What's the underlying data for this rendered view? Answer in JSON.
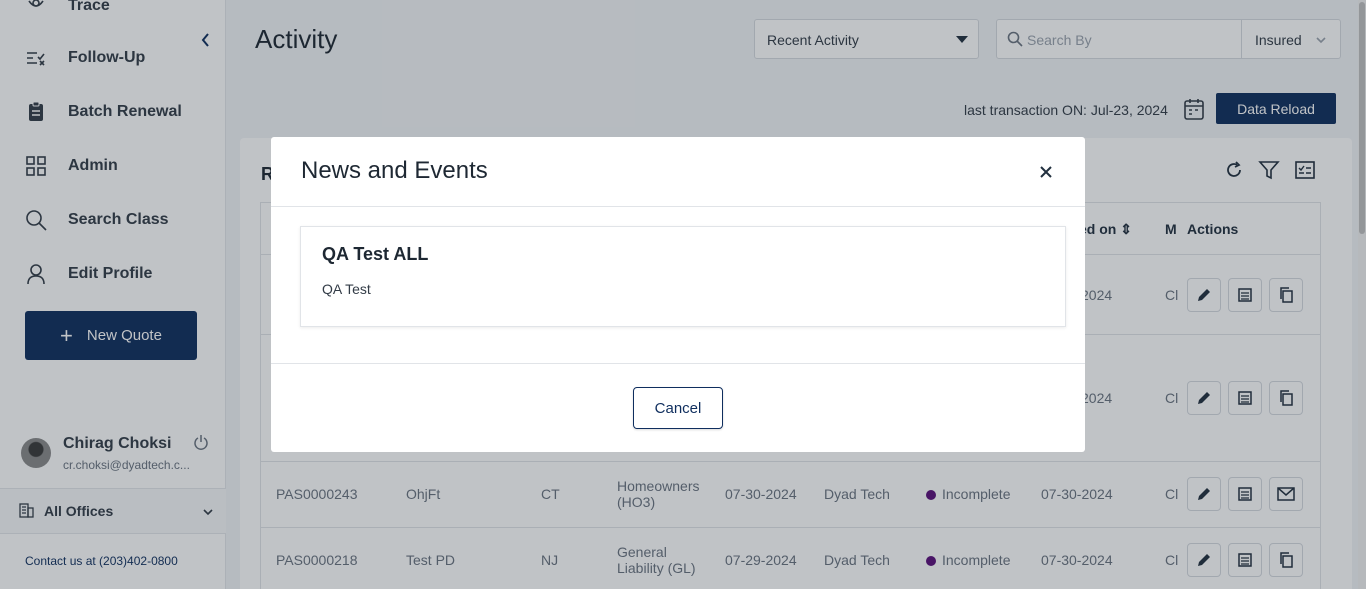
{
  "sidebar": {
    "items": [
      {
        "label": "Trace",
        "icon": "trace-icon"
      },
      {
        "label": "Follow-Up",
        "icon": "follow-up-icon"
      },
      {
        "label": "Batch Renewal",
        "icon": "clipboard-icon"
      },
      {
        "label": "Admin",
        "icon": "grid-icon"
      },
      {
        "label": "Search Class",
        "icon": "search-icon"
      },
      {
        "label": "Edit Profile",
        "icon": "user-icon"
      }
    ],
    "new_quote_label": "New Quote",
    "user_name": "Chirag Choksi",
    "user_email": "cr.choksi@dyadtech.c...",
    "offices_label": "All Offices",
    "contact": "Contact us at (203)402-0800"
  },
  "header": {
    "title": "Activity",
    "filter_selected": "Recent Activity",
    "search_placeholder": "Search By",
    "search_type": "Insured",
    "last_transaction": "last transaction ON: Jul-23, 2024",
    "reload_label": "Data Reload"
  },
  "table": {
    "card_title_fragment": "R",
    "headers": {
      "updated_on": "ed on",
      "m": "M",
      "actions": "Actions"
    },
    "rows": [
      {
        "year": "2024",
        "m": "Cl"
      },
      {
        "year": "2024",
        "m": "Cl"
      },
      {
        "policy": "PAS0000243",
        "insured": "OhjFt",
        "state": "CT",
        "lob": "Homeowners (HO3)",
        "date": "07-30-2024",
        "agency": "Dyad Tech",
        "status": "Incomplete",
        "updated": "07-30-2024",
        "m": "Cl"
      },
      {
        "policy": "PAS0000218",
        "insured": "Test PD",
        "state": "NJ",
        "lob": "General Liability (GL)",
        "date": "07-29-2024",
        "agency": "Dyad Tech",
        "status": "Incomplete",
        "updated": "07-30-2024",
        "m": "Cl"
      }
    ]
  },
  "modal": {
    "title": "News and Events",
    "news": [
      {
        "title": "QA Test ALL",
        "body": "QA Test"
      }
    ],
    "cancel_label": "Cancel"
  },
  "colors": {
    "primary": "#0f2e5e",
    "status_incomplete": "#5a0f7a"
  }
}
